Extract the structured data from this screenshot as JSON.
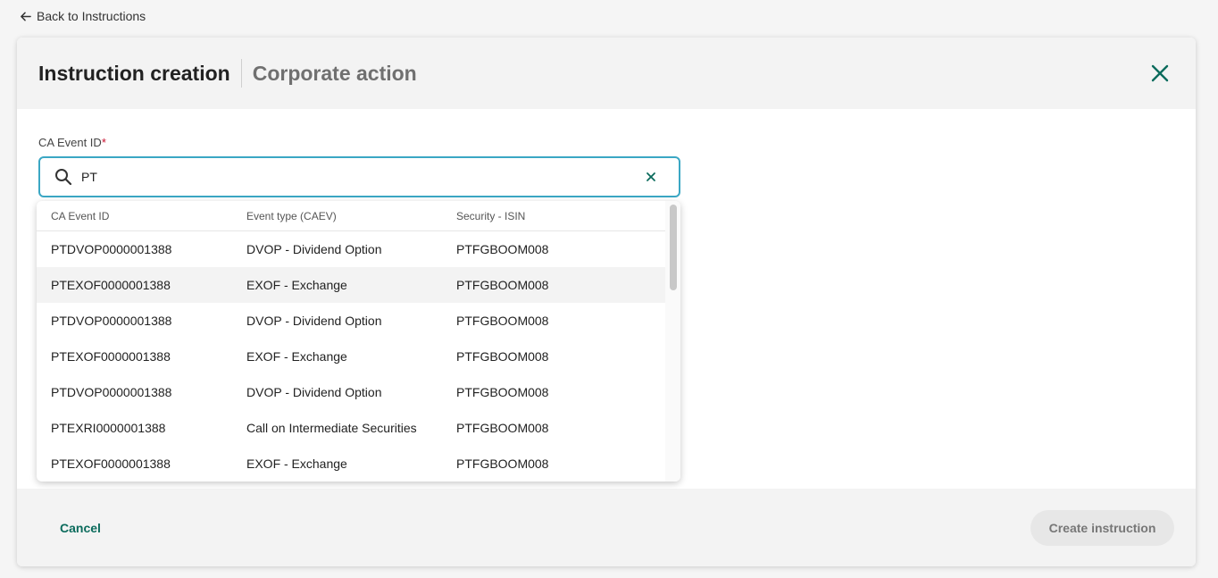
{
  "nav": {
    "back_label": "Back to Instructions"
  },
  "modal": {
    "title": "Instruction creation",
    "subtitle": "Corporate action"
  },
  "field": {
    "label": "CA Event ID",
    "required_mark": "*",
    "value": "PT"
  },
  "dropdown": {
    "columns": [
      "CA Event ID",
      "Event type (CAEV)",
      "Security - ISIN"
    ],
    "rows": [
      [
        "PTDVOP0000001388",
        "DVOP - Dividend Option",
        "PTFGBOOM008"
      ],
      [
        "PTEXOF0000001388",
        "EXOF - Exchange",
        "PTFGBOOM008"
      ],
      [
        "PTDVOP0000001388",
        "DVOP - Dividend Option",
        "PTFGBOOM008"
      ],
      [
        "PTEXOF0000001388",
        "EXOF - Exchange",
        "PTFGBOOM008"
      ],
      [
        "PTDVOP0000001388",
        "DVOP - Dividend Option",
        "PTFGBOOM008"
      ],
      [
        "PTEXRI0000001388",
        "Call on Intermediate Securities",
        "PTFGBOOM008"
      ],
      [
        "PTEXOF0000001388",
        "EXOF - Exchange",
        "PTFGBOOM008"
      ]
    ]
  },
  "footer": {
    "cancel_label": "Cancel",
    "create_label": "Create instruction"
  },
  "colors": {
    "accent": "#0b6b5c",
    "focus_border": "#3ba7c4",
    "required": "#c8102e"
  }
}
